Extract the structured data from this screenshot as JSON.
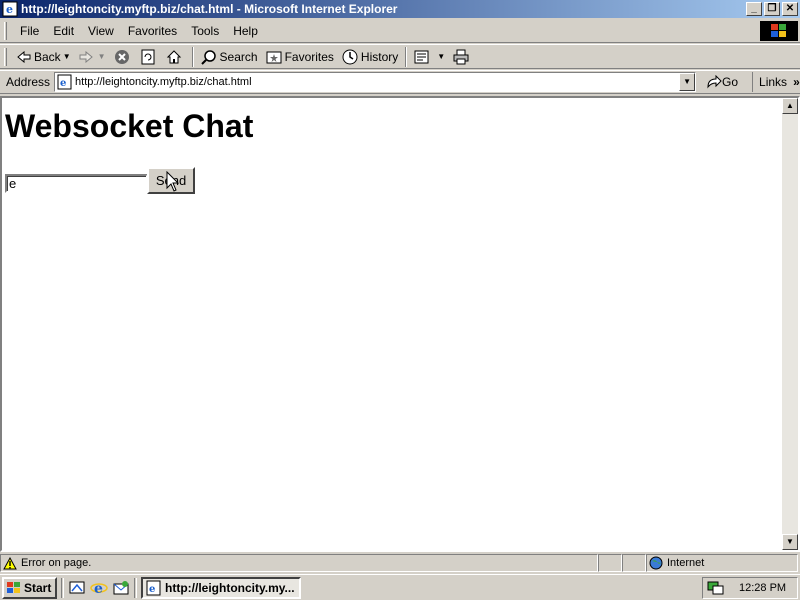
{
  "window": {
    "title": "http://leightoncity.myftp.biz/chat.html - Microsoft Internet Explorer",
    "minimize": "_",
    "restore": "❐",
    "close": "✕"
  },
  "menu": [
    "File",
    "Edit",
    "View",
    "Favorites",
    "Tools",
    "Help"
  ],
  "toolbar": {
    "back": "Back",
    "search": "Search",
    "favorites": "Favorites",
    "history": "History"
  },
  "address": {
    "label": "Address",
    "url": "http://leightoncity.myftp.biz/chat.html",
    "go": "Go",
    "links": "Links"
  },
  "page": {
    "heading": "Websocket Chat",
    "input_value": "e",
    "send_label": "Send"
  },
  "status": {
    "message": "Error on page.",
    "zone": "Internet"
  },
  "taskbar": {
    "start": "Start",
    "task_label": "http://leightoncity.my...",
    "clock": "12:28 PM"
  },
  "colors": {
    "titlebar": "#0a246a",
    "chrome": "#d4d0c8"
  }
}
